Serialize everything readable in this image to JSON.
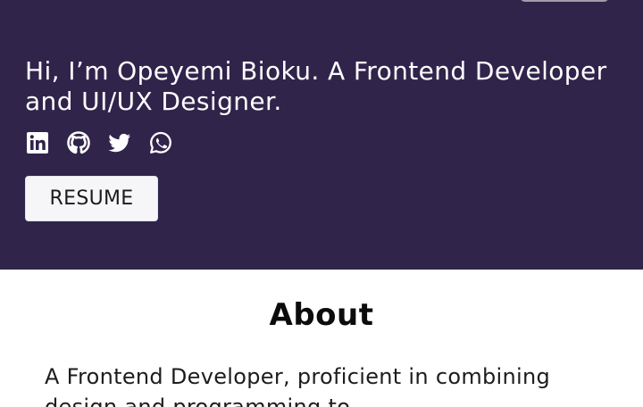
{
  "hero": {
    "title": "Hi, I’m Opeyemi Bioku. A Frontend Developer and UI/UX Designer.",
    "background_color": "#30244b",
    "socials": [
      {
        "icon": "linkedin-icon"
      },
      {
        "icon": "github-icon"
      },
      {
        "icon": "twitter-icon"
      },
      {
        "icon": "whatsapp-icon"
      }
    ],
    "resume_label": "RESUME"
  },
  "about": {
    "heading": "About",
    "text": "A Frontend Developer, proficient in combining design and programming to"
  }
}
